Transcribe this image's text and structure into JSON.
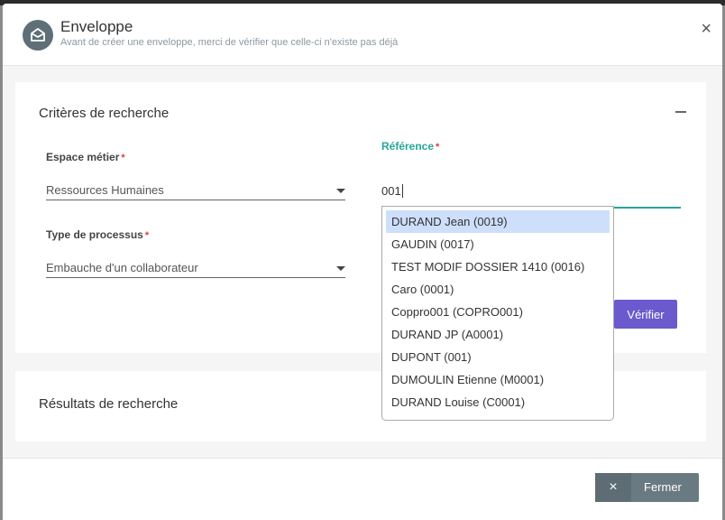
{
  "modal": {
    "title": "Enveloppe",
    "subtitle": "Avant de créer une enveloppe, merci de vérifier que celle-ci n'existe pas déjà",
    "close_label": "×"
  },
  "criteria": {
    "title": "Critères de recherche",
    "espace_metier": {
      "label": "Espace métier",
      "required": "*",
      "value": "Ressources Humaines"
    },
    "type_processus": {
      "label": "Type de processus",
      "required": "*",
      "value": "Embauche d'un collaborateur"
    },
    "reference": {
      "label": "Référence",
      "required": "*",
      "value": "001"
    },
    "verify_label": "Vérifier"
  },
  "suggestions": [
    "DURAND Jean (0019)",
    "GAUDIN (0017)",
    "TEST MODIF DOSSIER 1410 (0016)",
    "Caro (0001)",
    "Coppro001 (COPRO001)",
    "DURAND JP (A0001)",
    "DUPONT (001)",
    "DUMOULIN Etienne (M0001)",
    "DURAND Louise (C0001)"
  ],
  "results": {
    "title": "Résultats de recherche"
  },
  "footer": {
    "close_icon": "×",
    "close_label": "Fermer"
  },
  "colors": {
    "accent_teal": "#26a69a",
    "verify_purple": "#6a5acd",
    "footer_button": "#6a7a82",
    "highlight": "#cddffb"
  },
  "icons": {
    "header": "envelope-icon",
    "close": "close-icon",
    "collapse": "minus-icon",
    "caret": "caret-down-icon"
  }
}
